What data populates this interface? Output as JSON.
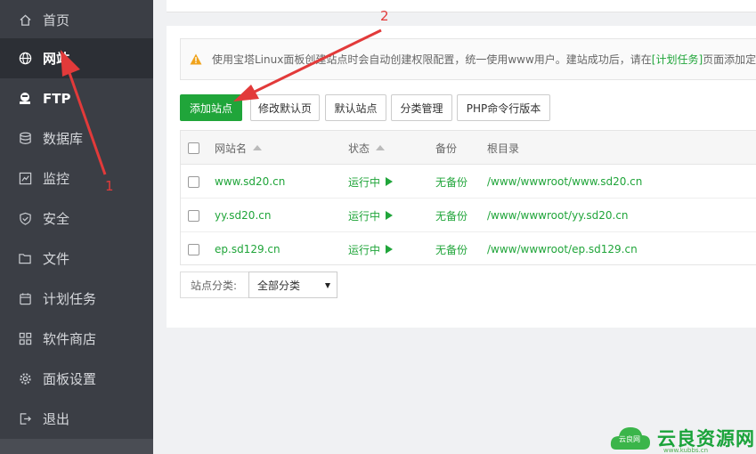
{
  "sidebar": {
    "items": [
      {
        "label": "首页",
        "icon": "home-icon"
      },
      {
        "label": "网站",
        "icon": "globe-icon"
      },
      {
        "label": "FTP",
        "icon": "ftp-icon"
      },
      {
        "label": "数据库",
        "icon": "database-icon"
      },
      {
        "label": "监控",
        "icon": "monitor-icon"
      },
      {
        "label": "安全",
        "icon": "shield-icon"
      },
      {
        "label": "文件",
        "icon": "folder-icon"
      },
      {
        "label": "计划任务",
        "icon": "calendar-icon"
      },
      {
        "label": "软件商店",
        "icon": "apps-icon"
      },
      {
        "label": "面板设置",
        "icon": "gear-icon"
      },
      {
        "label": "退出",
        "icon": "logout-icon"
      }
    ]
  },
  "notice": {
    "text_before": "使用宝塔Linux面板创建站点时会自动创建权限配置，统一使用www用户。建站成功后，请在",
    "link": "[计划任务]",
    "text_after": "页面添加定时"
  },
  "toolbar": {
    "add_site": "添加站点",
    "edit_default_page": "修改默认页",
    "default_site": "默认站点",
    "category_manage": "分类管理",
    "php_cli_version": "PHP命令行版本"
  },
  "table": {
    "headers": {
      "name": "网站名",
      "status": "状态",
      "backup": "备份",
      "root": "根目录"
    },
    "rows": [
      {
        "name": "www.sd20.cn",
        "status": "运行中",
        "backup": "无备份",
        "root": "/www/wwwroot/www.sd20.cn"
      },
      {
        "name": "yy.sd20.cn",
        "status": "运行中",
        "backup": "无备份",
        "root": "/www/wwwroot/yy.sd20.cn"
      },
      {
        "name": "ep.sd129.cn",
        "status": "运行中",
        "backup": "无备份",
        "root": "/www/wwwroot/ep.sd129.cn"
      }
    ]
  },
  "category": {
    "label": "站点分类:",
    "selected": "全部分类"
  },
  "annotations": {
    "one": "1",
    "two": "2"
  },
  "watermark": {
    "cloud_text": "云良网",
    "name": "云良资源网",
    "url": "www.kubbs.cn"
  },
  "colors": {
    "sidebar": "#3b3e45",
    "accent": "#20a53a",
    "annotation": "#e23a3a"
  }
}
